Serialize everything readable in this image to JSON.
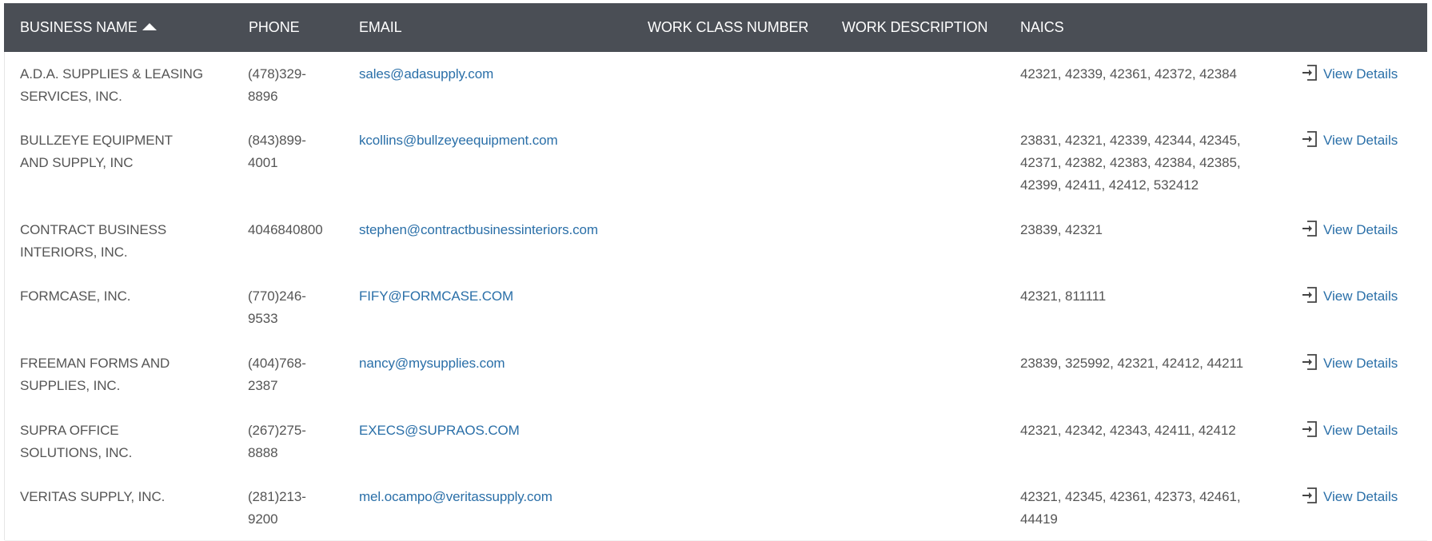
{
  "table": {
    "headers": {
      "business_name": "BUSINESS NAME",
      "phone": "PHONE",
      "email": "EMAIL",
      "work_class_number": "WORK CLASS NUMBER",
      "work_description": "WORK DESCRIPTION",
      "naics": "NAICS"
    },
    "sort": {
      "column": "business_name",
      "direction": "ascending",
      "icon": "sort-up-icon"
    },
    "view_details_label": "View Details",
    "view_details_icon": "sign-in-icon",
    "colors": {
      "header_bg": "#4a4e55",
      "link": "#2a6fa8",
      "text": "#555555"
    },
    "rows": [
      {
        "name_lines": [
          "A.D.A. SUPPLIES & LEASING",
          "SERVICES, INC."
        ],
        "phone_lines": [
          "(478)329-",
          "8896"
        ],
        "email": "sales@adasupply.com",
        "naics_lines": [
          "42321, 42339, 42361, 42372, 42384"
        ]
      },
      {
        "name_lines": [
          "BULLZEYE EQUIPMENT",
          "AND SUPPLY, INC"
        ],
        "phone_lines": [
          "(843)899-",
          "4001"
        ],
        "email": "kcollins@bullzeyeequipment.com",
        "naics_lines": [
          "23831, 42321, 42339, 42344, 42345,",
          "42371, 42382, 42383, 42384, 42385,",
          "42399, 42411, 42412, 532412"
        ]
      },
      {
        "name_lines": [
          "CONTRACT BUSINESS",
          "INTERIORS, INC."
        ],
        "phone_lines": [
          "4046840800"
        ],
        "email": "stephen@contractbusinessinteriors.com",
        "naics_lines": [
          "23839, 42321"
        ]
      },
      {
        "name_lines": [
          "FORMCASE, INC."
        ],
        "phone_lines": [
          "(770)246-",
          "9533"
        ],
        "email": "FIFY@FORMCASE.COM",
        "naics_lines": [
          "42321, 811111"
        ]
      },
      {
        "name_lines": [
          "FREEMAN FORMS AND",
          "SUPPLIES, INC."
        ],
        "phone_lines": [
          "(404)768-",
          "2387"
        ],
        "email": "nancy@mysupplies.com",
        "naics_lines": [
          "23839, 325992, 42321, 42412, 44211"
        ]
      },
      {
        "name_lines": [
          "SUPRA OFFICE",
          "SOLUTIONS, INC."
        ],
        "phone_lines": [
          "(267)275-",
          "8888"
        ],
        "email": "EXECS@SUPRAOS.COM",
        "naics_lines": [
          "42321, 42342, 42343, 42411, 42412"
        ]
      },
      {
        "name_lines": [
          "VERITAS SUPPLY, INC."
        ],
        "phone_lines": [
          "(281)213-",
          "9200"
        ],
        "email": "mel.ocampo@veritassupply.com",
        "naics_lines": [
          "42321, 42345, 42361, 42373, 42461,",
          "44419"
        ]
      }
    ]
  }
}
